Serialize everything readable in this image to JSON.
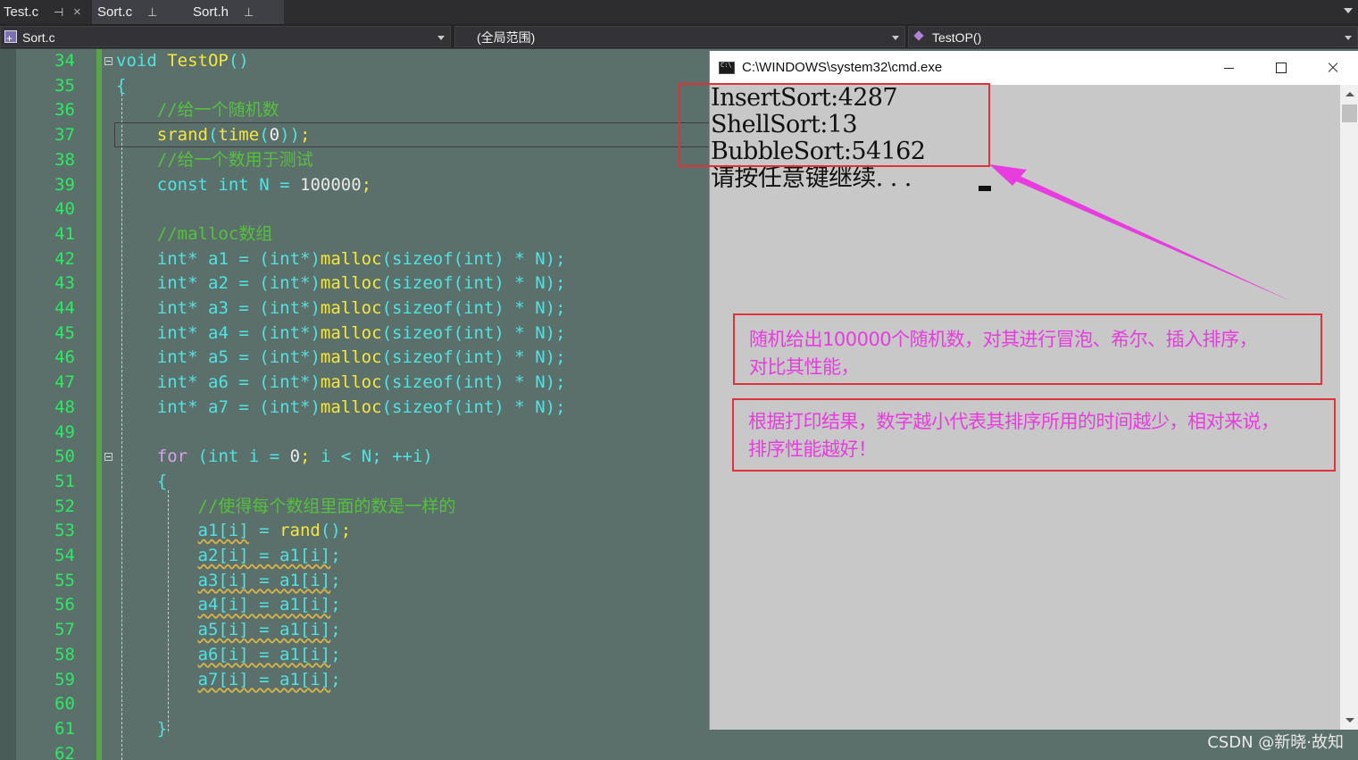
{
  "tabs": [
    {
      "label": "Test.c",
      "pin": "⊣",
      "close": "×"
    },
    {
      "label": "Sort.c",
      "pin": "⊥"
    },
    {
      "label": "Sort.h",
      "pin": "⊥"
    }
  ],
  "nav": {
    "file": "Sort.c",
    "scope": "(全局范围)",
    "function": "TestOP()"
  },
  "editor": {
    "line_numbers": [
      "34",
      "35",
      "36",
      "37",
      "38",
      "39",
      "40",
      "41",
      "42",
      "43",
      "44",
      "45",
      "46",
      "47",
      "48",
      "49",
      "50",
      "51",
      "52",
      "53",
      "54",
      "55",
      "56",
      "57",
      "58",
      "59",
      "60",
      "61",
      "62"
    ]
  },
  "cmd": {
    "title": "C:\\WINDOWS\\system32\\cmd.exe",
    "output": [
      "InsertSort:4287",
      "ShellSort:13",
      "BubbleSort:54162",
      "请按任意键继续. . ."
    ]
  },
  "notes": {
    "note1_line1": "随机给出100000个随机数，对其进行冒泡、希尔、插入排序，",
    "note1_line2": "对比其性能，",
    "note2_line1": "根据打印结果，数字越小代表其排序所用的时间越少，相对来说，",
    "note2_line2": "排序性能越好！"
  },
  "watermark": "CSDN @新晓·故知",
  "colors": {
    "annotation_red": "#e0323a",
    "annotation_magenta": "#e93ce0",
    "line_number_green": "#2bea63"
  }
}
